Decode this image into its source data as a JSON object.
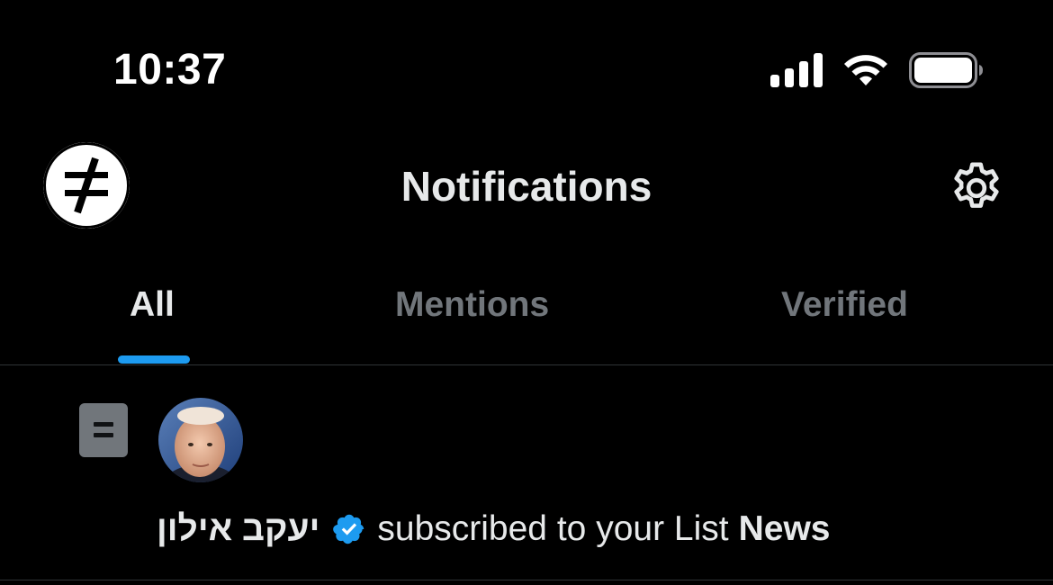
{
  "status_bar": {
    "time": "10:37",
    "icons": [
      "cellular-signal-icon",
      "wifi-icon",
      "battery-icon"
    ]
  },
  "header": {
    "title": "Notifications",
    "logo_icon": "not-equal-logo-icon",
    "settings_icon": "gear-icon"
  },
  "tabs": [
    {
      "label": "All",
      "active": true
    },
    {
      "label": "Mentions",
      "active": false
    },
    {
      "label": "Verified",
      "active": false
    }
  ],
  "notifications": [
    {
      "type_icon": "list-icon",
      "user_name": "יעקב אילון",
      "verified": true,
      "action": "subscribed to your List",
      "list_name": "News"
    }
  ],
  "colors": {
    "background": "#000000",
    "text_primary": "#e7e9ea",
    "text_secondary": "#71767b",
    "accent": "#1d9bf0",
    "divider": "#2f3336"
  }
}
